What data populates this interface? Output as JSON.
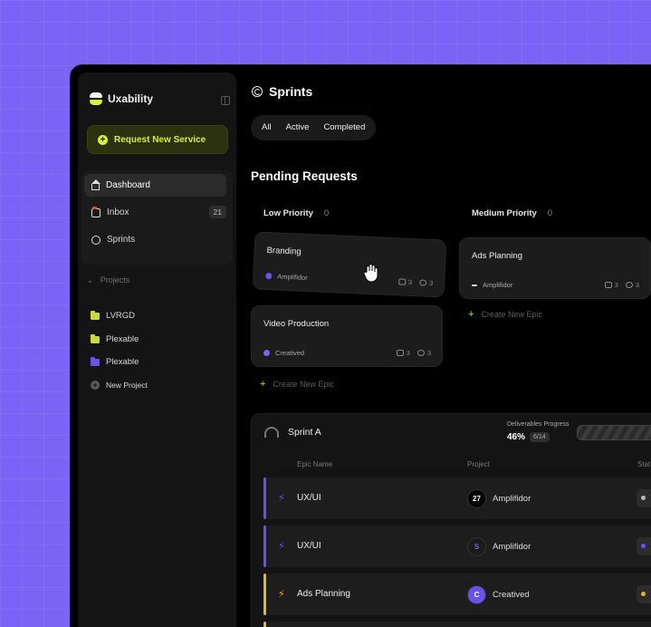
{
  "brand": {
    "name": "Uxability"
  },
  "sidebar": {
    "request_button": "Request New Service",
    "nav": [
      {
        "label": "Dashboard",
        "icon": "home-icon",
        "active": true
      },
      {
        "label": "Inbox",
        "icon": "inbox-icon",
        "badge": "21"
      },
      {
        "label": "Sprints",
        "icon": "circle-icon"
      }
    ],
    "projects_header": "Projects",
    "projects": [
      {
        "label": "LVRGD",
        "color": "#c7dc3a"
      },
      {
        "label": "Plexable",
        "color": "#c7dc3a"
      },
      {
        "label": "Plexable",
        "color": "#6b52f0"
      }
    ],
    "new_project": "New Project"
  },
  "main": {
    "title": "Sprints",
    "filters": [
      "All",
      "Active",
      "Completed"
    ],
    "section_title": "Pending Requests",
    "columns": [
      {
        "label": "Low Priority",
        "count": "0",
        "cards": [
          {
            "title": "Branding",
            "project": "Amplifidor",
            "comments": "3",
            "attachments": "3"
          },
          {
            "title": "Video Production",
            "project": "Creatived",
            "comments": "3",
            "attachments": "3"
          }
        ],
        "create": "Create New Epic"
      },
      {
        "label": "Medium Priority",
        "count": "0",
        "cards": [
          {
            "title": "Ads Planning",
            "project": "Amplifidor",
            "comments": "3",
            "attachments": "3"
          }
        ],
        "create": "Create New Epic"
      }
    ]
  },
  "sprint": {
    "name": "Sprint A",
    "deliverables_label": "Deliverables Progress",
    "deliverables_percent": "46%",
    "deliverables_count": "6/14",
    "progress_fraction": 0.46,
    "columns": {
      "epic": "Epic Name",
      "project": "Project",
      "status": "Stat"
    },
    "rows": [
      {
        "epic": "UX/UI",
        "project": "Amplifidor",
        "logo": "27",
        "accent": "#6b52f0",
        "status_color": "#bbbbbb"
      },
      {
        "epic": "UX/UI",
        "project": "Amplifidor",
        "logo": "S",
        "accent": "#6b52f0",
        "status_color": "#6b52f0"
      },
      {
        "epic": "Ads Planning",
        "project": "Creatived",
        "logo": "C",
        "accent": "#e5b52b",
        "status_color": "#e5b52b"
      }
    ]
  }
}
